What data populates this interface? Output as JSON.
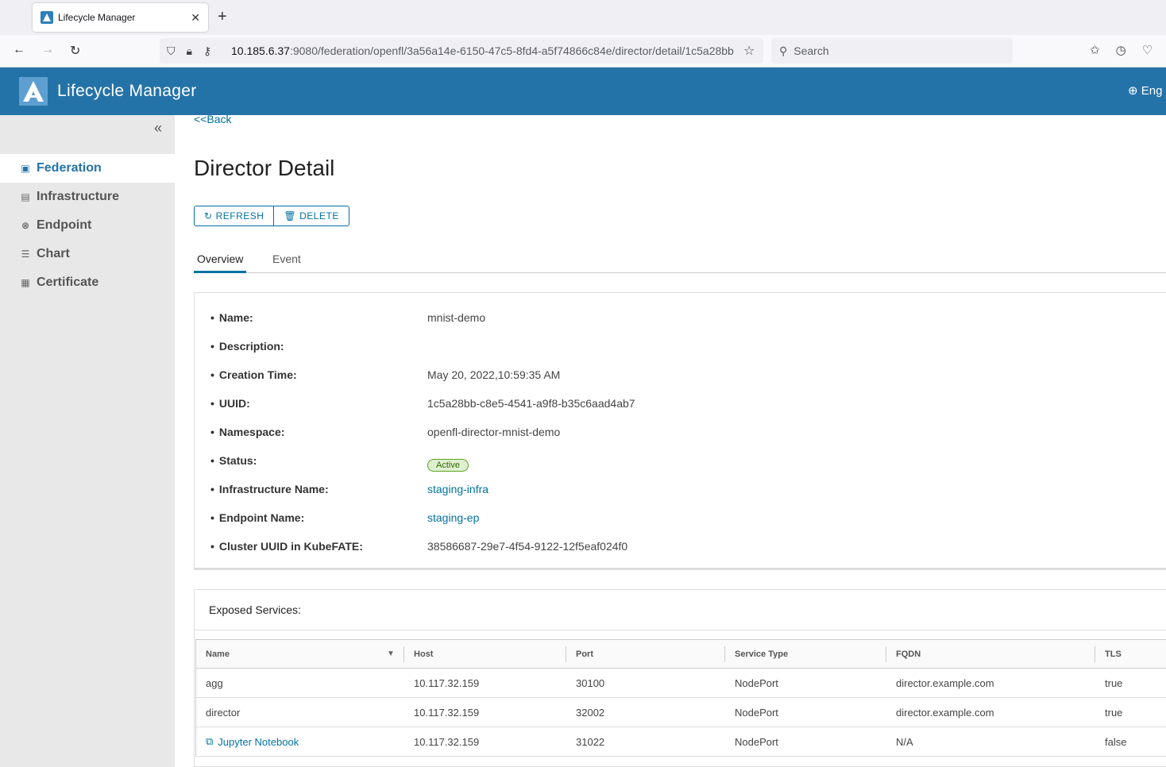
{
  "browser": {
    "tab_title": "Lifecycle Manager",
    "url_host": "10.185.6.37",
    "url_path": ":9080/federation/openfl/3a56a14e-6150-47c5-8fd4-a5f74866c84e/director/detail/1c5a28bb",
    "search_placeholder": "Search"
  },
  "header": {
    "app_title": "Lifecycle Manager",
    "language": "Eng"
  },
  "sidebar": {
    "items": [
      {
        "label": "Federation",
        "icon": "federation-icon",
        "active": true
      },
      {
        "label": "Infrastructure",
        "icon": "infrastructure-icon",
        "active": false
      },
      {
        "label": "Endpoint",
        "icon": "endpoint-icon",
        "active": false
      },
      {
        "label": "Chart",
        "icon": "chart-icon",
        "active": false
      },
      {
        "label": "Certificate",
        "icon": "certificate-icon",
        "active": false
      }
    ]
  },
  "main": {
    "back_label": "<<Back",
    "title": "Director Detail",
    "refresh_label": "REFRESH",
    "delete_label": "DELETE",
    "tabs": [
      "Overview",
      "Event"
    ],
    "details": {
      "name_label": "Name:",
      "name": "mnist-demo",
      "description_label": "Description:",
      "description": "",
      "creation_label": "Creation Time:",
      "creation": "May 20, 2022,10:59:35 AM",
      "uuid_label": "UUID:",
      "uuid": "1c5a28bb-c8e5-4541-a9f8-b35c6aad4ab7",
      "namespace_label": "Namespace:",
      "namespace": "openfl-director-mnist-demo",
      "status_label": "Status:",
      "status": "Active",
      "infra_label": "Infrastructure Name:",
      "infra": "staging-infra",
      "endpoint_label": "Endpoint Name:",
      "endpoint": "staging-ep",
      "cluster_label": "Cluster UUID in KubeFATE:",
      "cluster": "38586687-29e7-4f54-9122-12f5eaf024f0"
    },
    "services": {
      "title": "Exposed Services:",
      "columns": [
        "Name",
        "Host",
        "Port",
        "Service Type",
        "FQDN",
        "TLS"
      ],
      "rows": [
        {
          "name": "agg",
          "host": "10.117.32.159",
          "port": "30100",
          "type": "NodePort",
          "fqdn": "director.example.com",
          "tls": "true"
        },
        {
          "name": "director",
          "host": "10.117.32.159",
          "port": "32002",
          "type": "NodePort",
          "fqdn": "director.example.com",
          "tls": "true"
        },
        {
          "name": "Jupyter Notebook",
          "host": "10.117.32.159",
          "port": "31022",
          "type": "NodePort",
          "fqdn": "N/A",
          "tls": "false"
        }
      ]
    }
  }
}
